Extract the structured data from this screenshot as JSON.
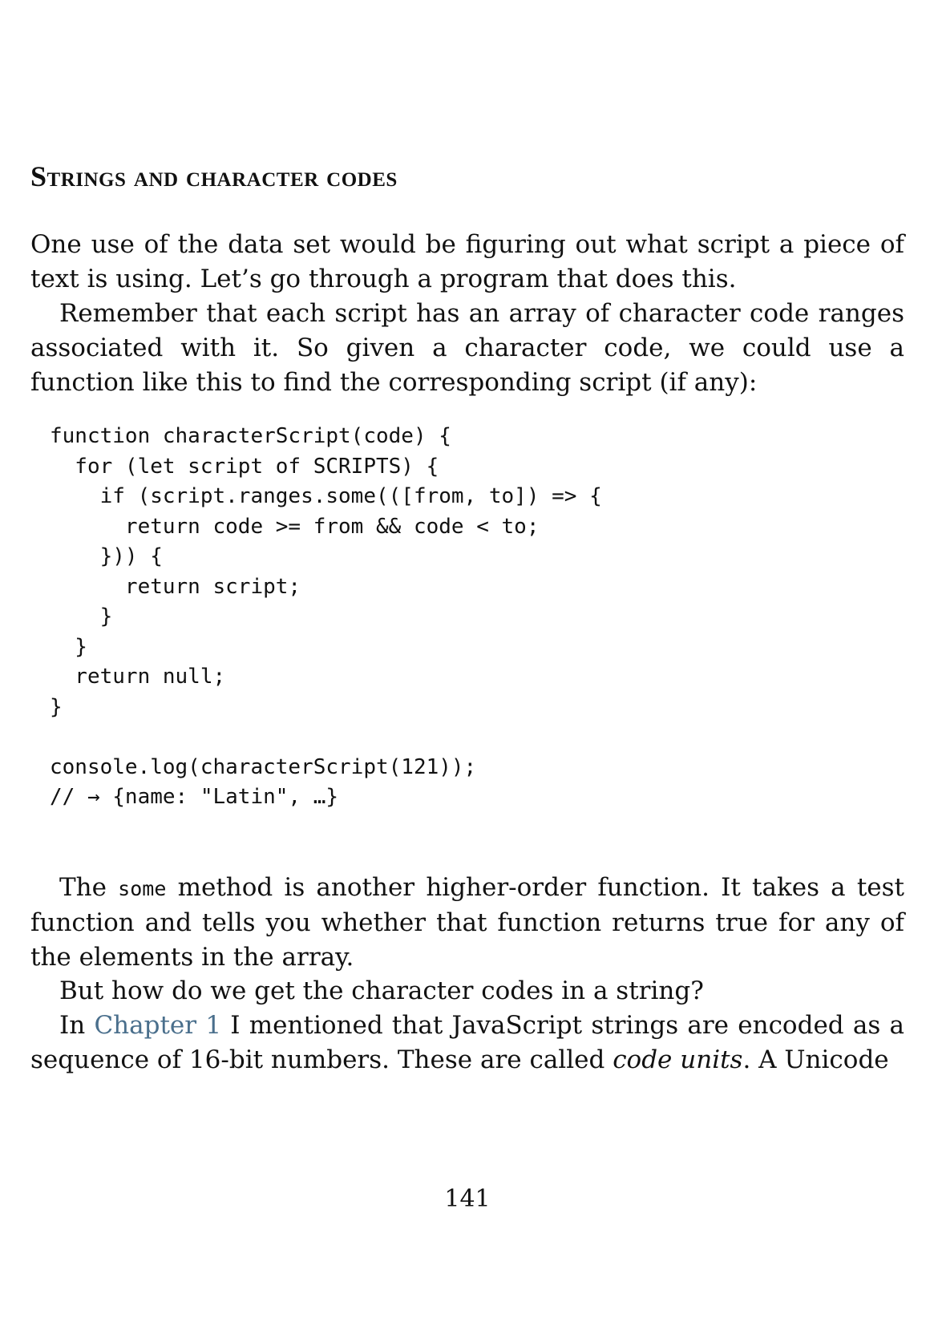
{
  "section": {
    "heading": "Strings and character codes"
  },
  "paragraphs": {
    "p1": "One use of the data set would be figuring out what script a piece of text is using. Let’s go through a program that does this.",
    "p2": "Remember that each script has an array of character code ranges associated with it. So given a character code, we could use a function like this to find the corresponding script (if any):",
    "p3_before": "The ",
    "p3_code": "some",
    "p3_after": " method is another higher-order function. It takes a test function and tells you whether that function returns true for any of the elements in the array.",
    "p4": "But how do we get the character codes in a string?",
    "p5_before": "In ",
    "p5_link": "Chapter 1",
    "p5_middle": " I mentioned that JavaScript strings are encoded as a sequence of 16-bit numbers. These are called ",
    "p5_em": "code units",
    "p5_after": ". A Unicode"
  },
  "code_block": {
    "text": "function characterScript(code) {\n  for (let script of SCRIPTS) {\n    if (script.ranges.some(([from, to]) => {\n      return code >= from && code < to;\n    })) {\n      return script;\n    }\n  }\n  return null;\n}\n\nconsole.log(characterScript(121));\n// → {name: \"Latin\", …}"
  },
  "footer": {
    "page_number": "141"
  }
}
